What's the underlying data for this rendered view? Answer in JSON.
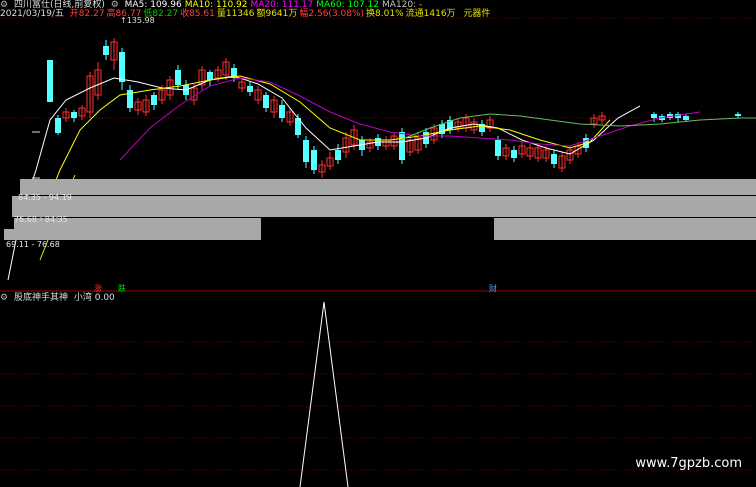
{
  "header": {
    "title": "四川富仕(日线,前复权)",
    "ma_line": [
      {
        "label": "MA5",
        "value": "109.96",
        "color": "#ffffff"
      },
      {
        "label": "MA10",
        "value": "110.92",
        "color": "#ffff00"
      },
      {
        "label": "MA20",
        "value": "111.17",
        "color": "#ff00ff"
      },
      {
        "label": "MA60",
        "value": "107.12",
        "color": "#00ff00"
      },
      {
        "label": "MA120",
        "value": "-",
        "color": "#c0c0c0"
      }
    ],
    "date": "2021/03/19/五",
    "info": [
      {
        "label": "开",
        "value": "82.27",
        "color": "#ff4040"
      },
      {
        "label": "高",
        "value": "86.77",
        "color": "#ff4040"
      },
      {
        "label": "低",
        "value": "82.27",
        "color": "#00d000"
      },
      {
        "label": "收",
        "value": "85.61",
        "color": "#ff4040"
      },
      {
        "label": "量",
        "value": "11346",
        "color": "#e0e000"
      },
      {
        "label": "额",
        "value": "9641万",
        "color": "#e0e000"
      },
      {
        "label": "幅",
        "value": "2.56(3.08%)",
        "color": "#ff4040"
      },
      {
        "label": "换",
        "value": "8.01%",
        "color": "#e0e000"
      },
      {
        "label": "流通",
        "value": "1416万",
        "color": "#e0e000"
      }
    ],
    "sector": "元器件"
  },
  "price_labels": {
    "high_marker": "135.98",
    "left_ticks": [
      "—",
      "—",
      "—"
    ]
  },
  "volume_profile": {
    "ranges": [
      "84.35 - 94.19",
      "76.68 - 84.35",
      "69.11 - 76.68"
    ]
  },
  "markers": [
    {
      "text": "涨",
      "color": "#ff3030"
    },
    {
      "text": "跌",
      "color": "#00e000"
    },
    {
      "text": "财",
      "color": "#4aa0ff"
    }
  ],
  "indicator": {
    "name": "股底神手其神",
    "series_label": "小湾",
    "value": "0.00"
  },
  "watermark": "www.7gpzb.com",
  "colors": {
    "up": "#ff3030",
    "down": "#54ffff",
    "ma5": "#ffffff",
    "ma10": "#ffff00",
    "ma20": "#c000c0",
    "ma60": "#60c060",
    "grid": "#6a0000"
  }
}
